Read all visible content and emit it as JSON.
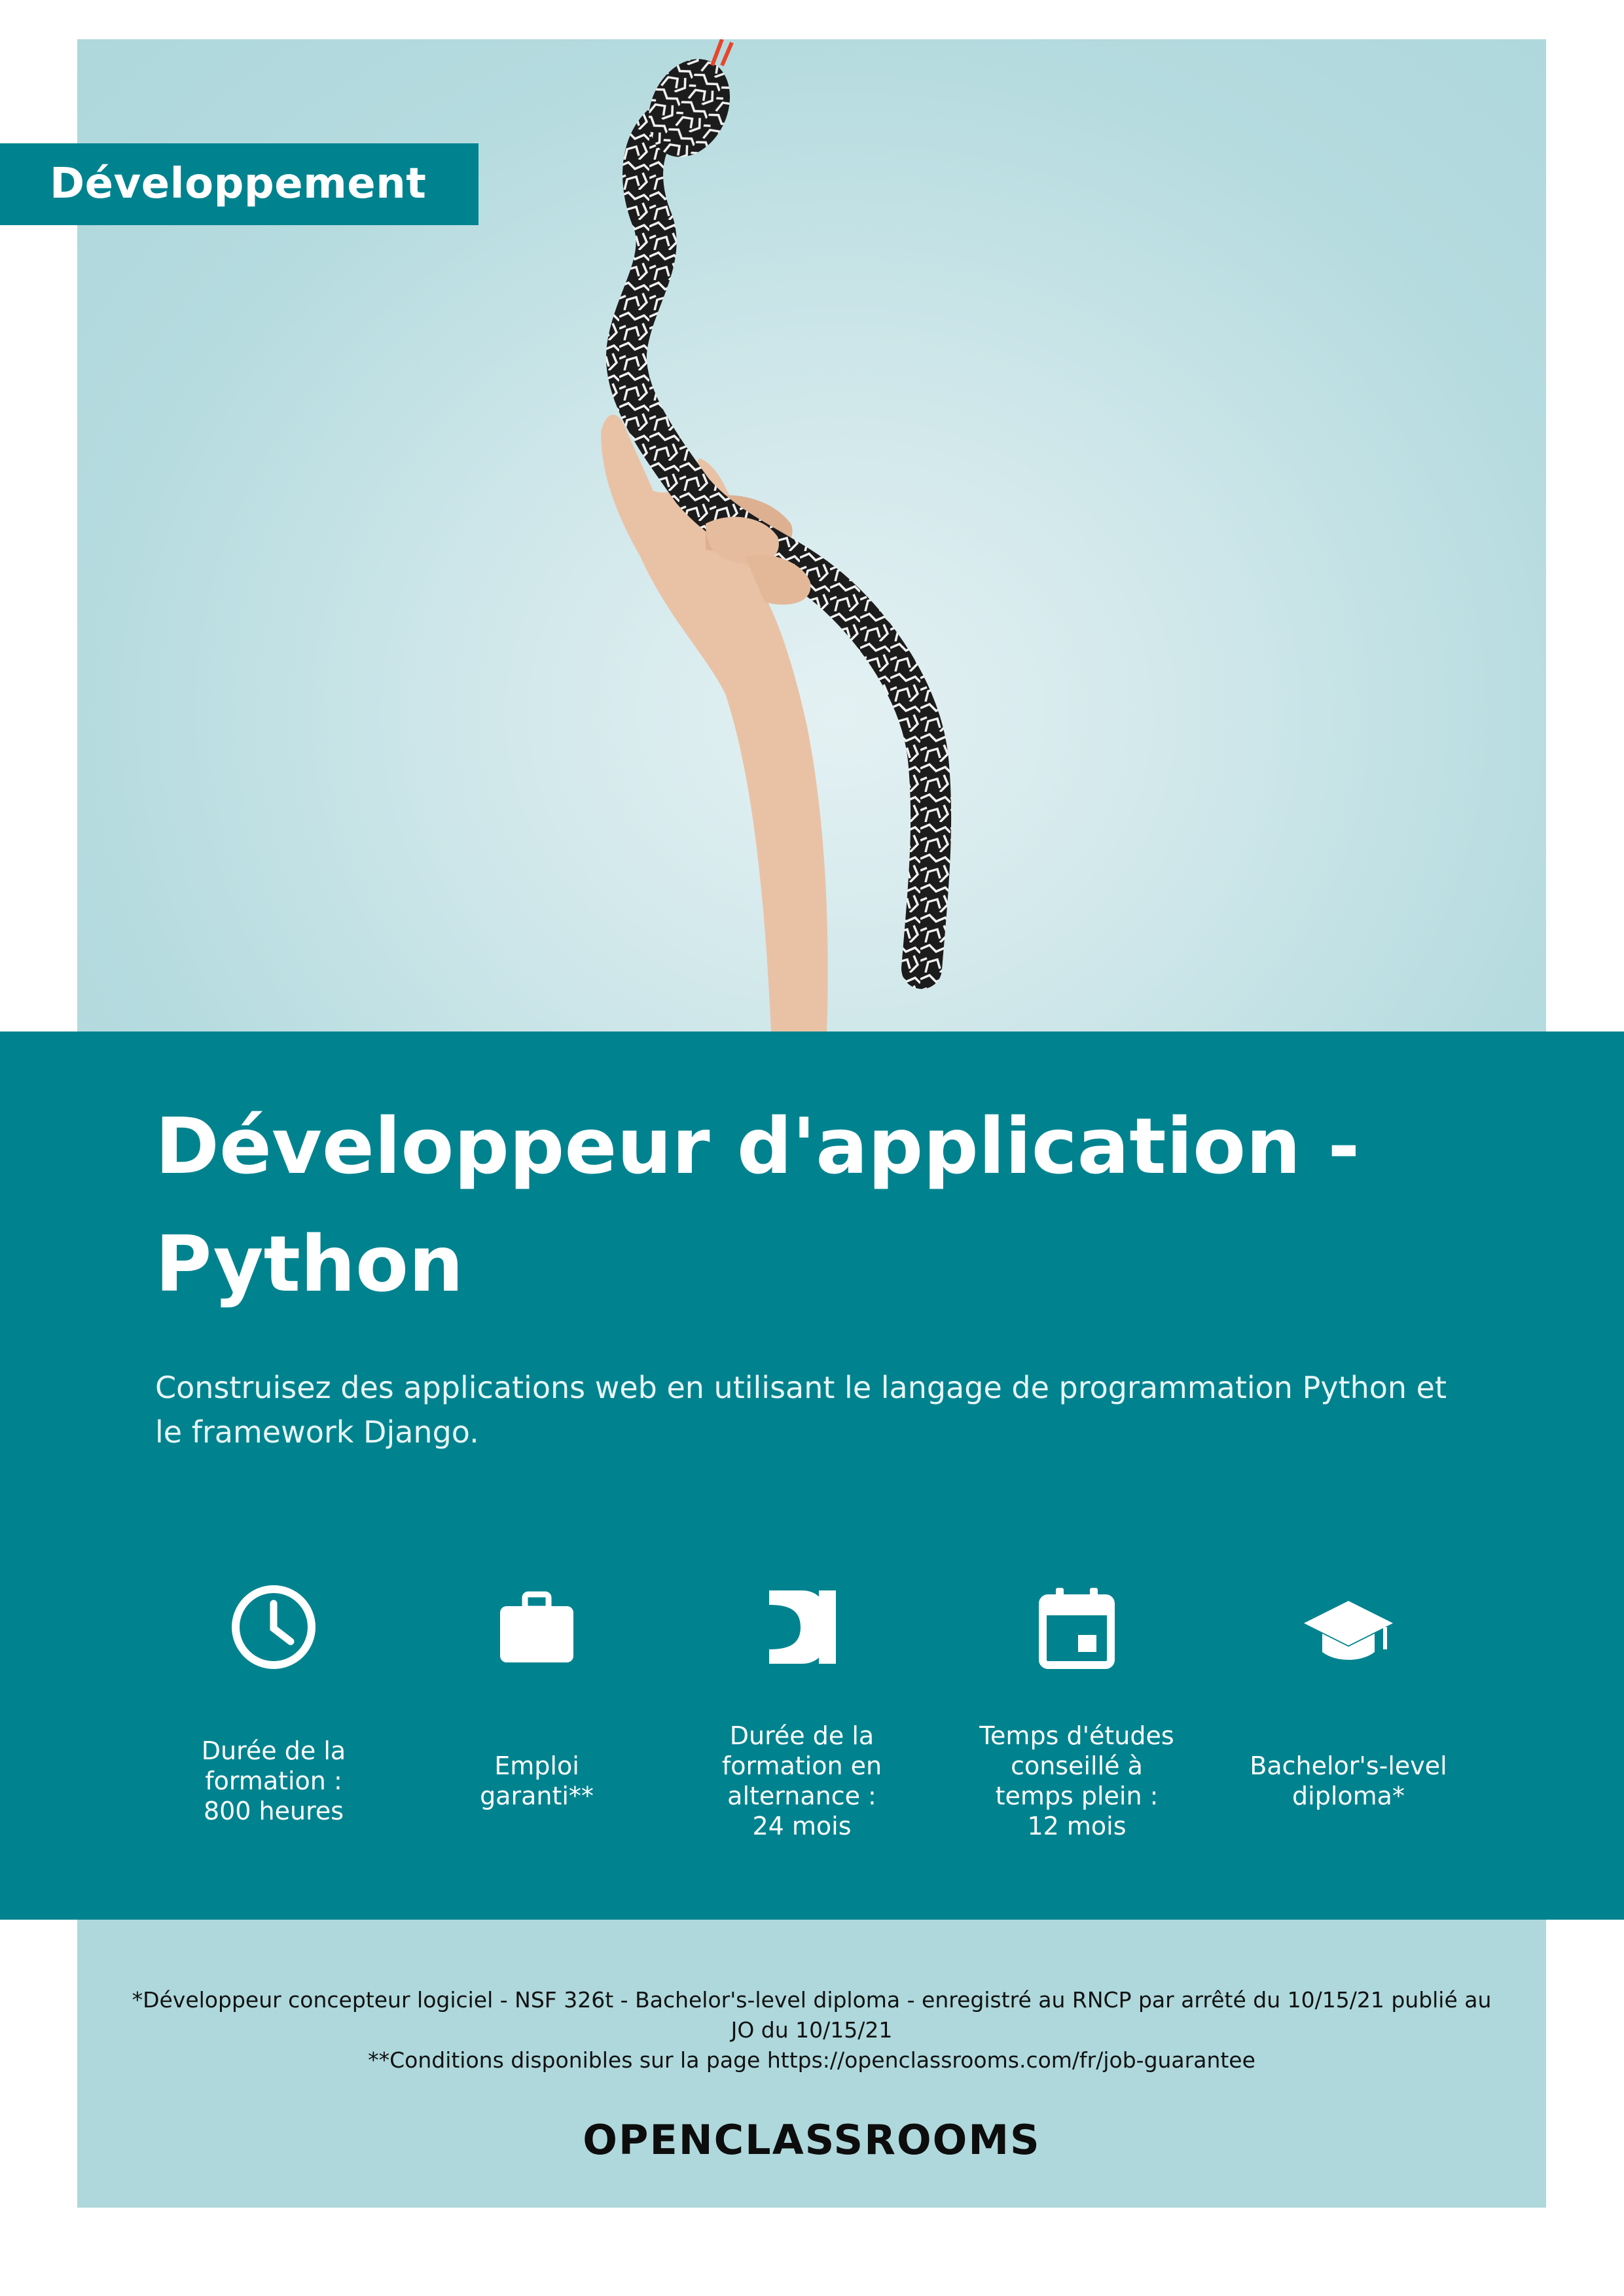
{
  "category_tag": "Développement",
  "title": "Développeur d'application - Python",
  "subtitle": "Construisez des applications web en utilisant le langage de programmation Python et le framework Django.",
  "features": [
    {
      "icon": "clock-icon",
      "label": "Durée de la\nformation :\n800 heures"
    },
    {
      "icon": "briefcase-icon",
      "label": "Emploi\ngaranti**"
    },
    {
      "icon": "openclassrooms-mark-icon",
      "label": "Durée de la\nformation en\nalternance :\n24 mois"
    },
    {
      "icon": "calendar-icon",
      "label": "Temps d'études\nconseillé à\ntemps plein :\n12 mois"
    },
    {
      "icon": "graduation-cap-icon",
      "label": "Bachelor's-level\ndiploma*"
    }
  ],
  "footnotes": {
    "diploma": "*Développeur concepteur logiciel - NSF 326t - Bachelor's-level diploma - enregistré au RNCP par arrêté du 10/15/21 publié au JO du 10/15/21",
    "conditions": "**Conditions disponibles sur la page https://openclassrooms.com/fr/job-guarantee"
  },
  "logo": "OPENCLASSROOMS",
  "colors": {
    "teal": "#00838f",
    "light_teal": "#aed8dc",
    "white": "#ffffff"
  }
}
